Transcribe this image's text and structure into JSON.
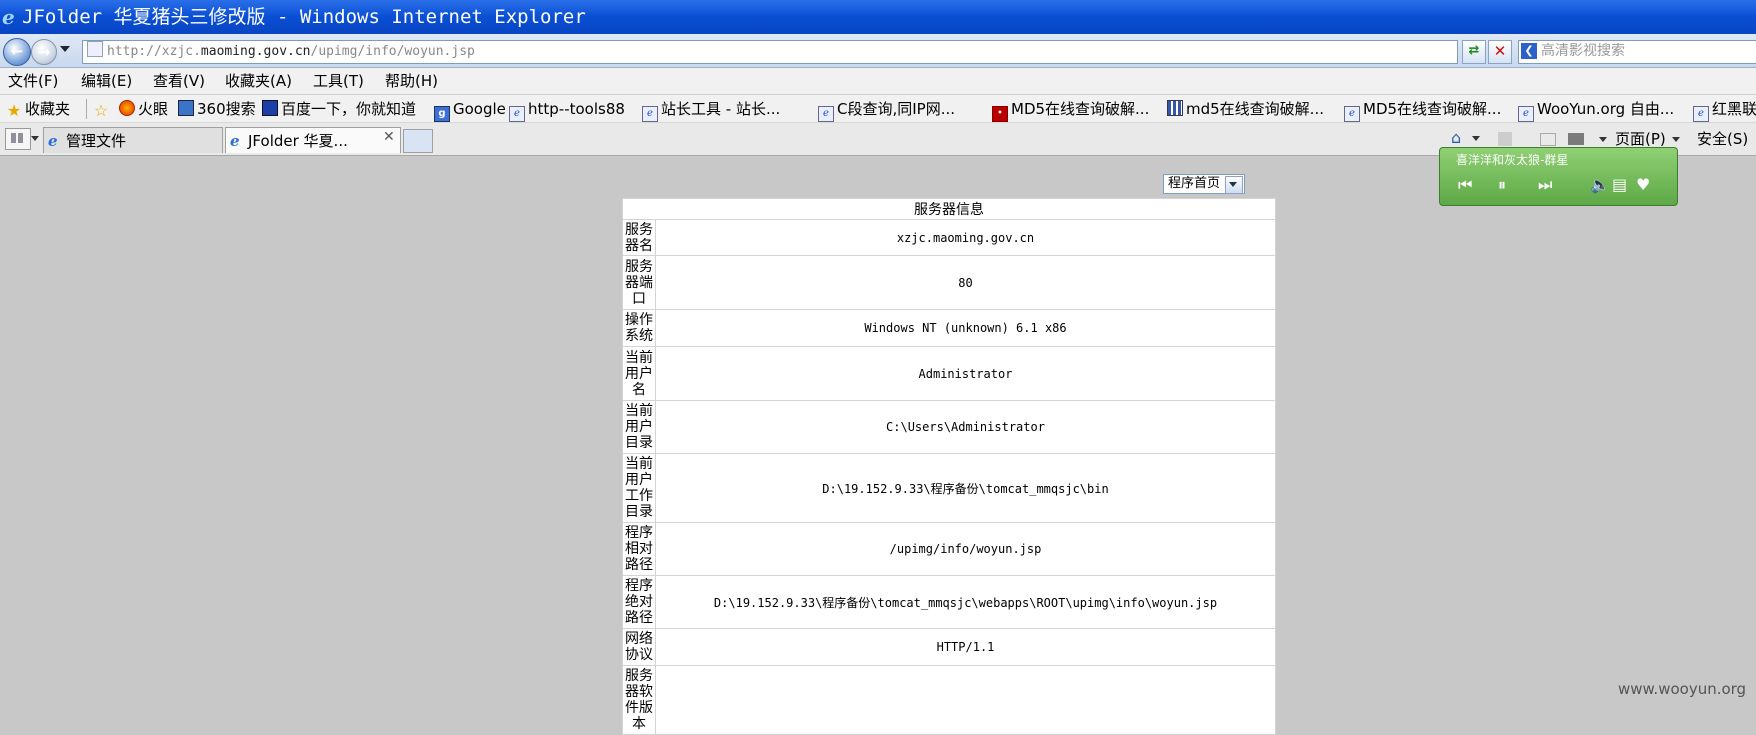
{
  "window": {
    "title": "JFolder 华夏猪头三修改版 - Windows Internet Explorer"
  },
  "address_bar": {
    "url_prefix": "http://xzjc.",
    "url_domain": "maoming.gov.cn",
    "url_path": "/upimg/info/woyun.jsp"
  },
  "search": {
    "placeholder": "高清影视搜索"
  },
  "menu": [
    "文件(F)",
    "编辑(E)",
    "查看(V)",
    "收藏夹(A)",
    "工具(T)",
    "帮助(H)"
  ],
  "favorites": {
    "label": "收藏夹",
    "items": [
      "火眼",
      "360搜索",
      "百度一下，你就知道",
      "Google",
      "http--tools88",
      "站长工具 - 站长...",
      "C段查询,同IP网...",
      "MD5在线查询破解...",
      "md5在线查询破解...",
      "MD5在线查询破解...",
      "WooYun.org 自由...",
      "红黑联"
    ]
  },
  "tabs": [
    {
      "label": "管理文件"
    },
    {
      "label": "JFolder 华夏..."
    }
  ],
  "commands": {
    "page": "页面(P)",
    "safety": "安全(S)"
  },
  "music": {
    "song": "喜洋洋和灰太狼-群星"
  },
  "content": {
    "select_value": "程序首页",
    "table_title": "服务器信息",
    "rows": [
      {
        "label": "服务器名",
        "value": "xzjc.maoming.gov.cn"
      },
      {
        "label": "服务器端口",
        "value": "80"
      },
      {
        "label": "操作系统",
        "value": "Windows NT (unknown) 6.1 x86"
      },
      {
        "label": "当前用户名",
        "value": "Administrator"
      },
      {
        "label": "当前用户目录",
        "value": "C:\\Users\\Administrator"
      },
      {
        "label": "当前用户工作目录",
        "value": "D:\\19.152.9.33\\程序备份\\tomcat_mmqsjc\\bin"
      },
      {
        "label": "程序相对路径",
        "value": "/upimg/info/woyun.jsp"
      },
      {
        "label": "程序绝对路径",
        "value": "D:\\19.152.9.33\\程序备份\\tomcat_mmqsjc\\webapps\\ROOT\\upimg\\info\\woyun.jsp"
      },
      {
        "label": "网络协议",
        "value": "HTTP/1.1"
      },
      {
        "label": "服务器软件版本",
        "value": ""
      }
    ]
  },
  "watermark": "www.wooyun.org"
}
